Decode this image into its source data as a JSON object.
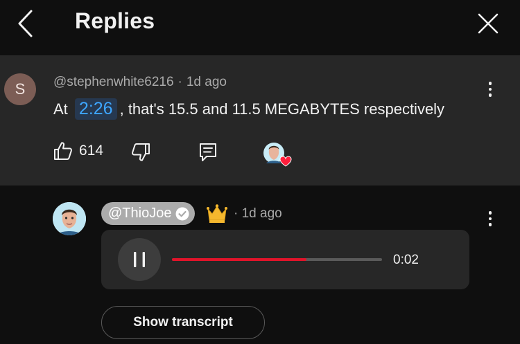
{
  "header": {
    "title": "Replies",
    "back_icon": "chevron-left-icon",
    "close_icon": "close-icon"
  },
  "parent_comment": {
    "avatar_initial": "S",
    "username": "@stephenwhite6216",
    "separator": "·",
    "time_ago": "1d ago",
    "text_before": "At",
    "timestamp": "2:26",
    "text_after": ", that's 15.5 and 11.5 MEGABYTES respectively",
    "like_count": "614"
  },
  "reply": {
    "author": "@ThioJoe",
    "verified": true,
    "separator": "·",
    "time_ago": "1d ago",
    "audio": {
      "elapsed": "0:02",
      "progress": 0.64,
      "state": "playing"
    },
    "transcript_label": "Show transcript"
  },
  "colors": {
    "background": "#0f0f0f",
    "card": "#272727",
    "link": "#3ea6ff",
    "progress": "#e1142a",
    "heart": "#ff1e3c",
    "crown": "#f5b82e"
  }
}
